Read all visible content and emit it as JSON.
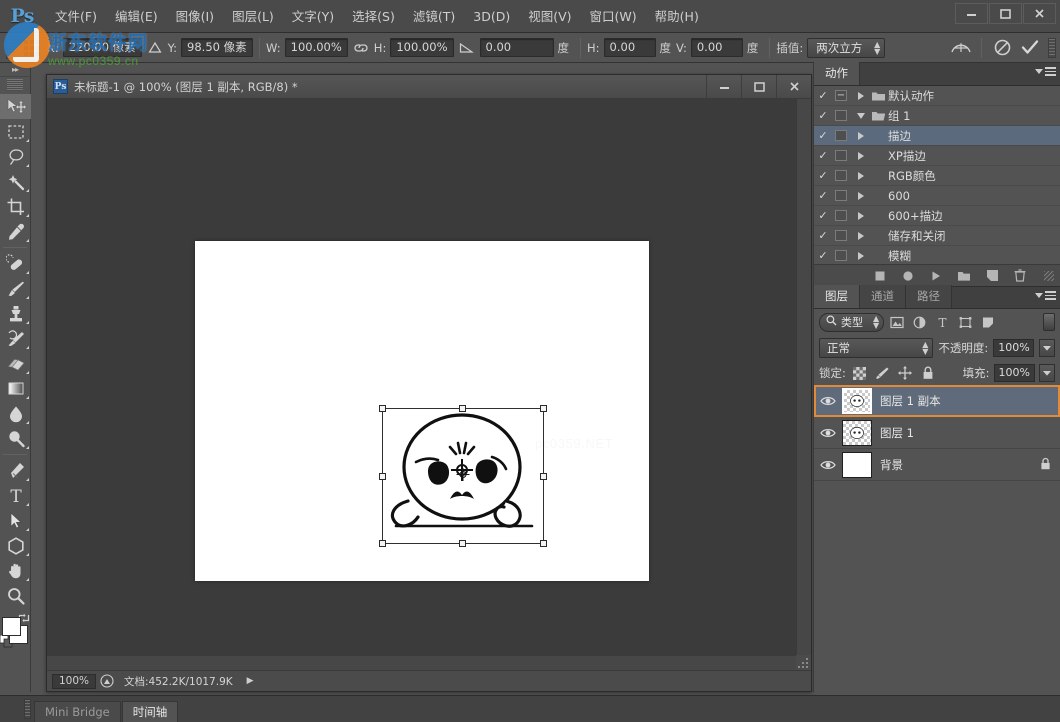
{
  "app": {
    "name": "Adobe Photoshop",
    "logo_text": "Ps"
  },
  "watermark": {
    "brand": "浙东软件网",
    "url": "www.pc0359.cn",
    "canvas_text": "pc0359.NET"
  },
  "menubar": {
    "items": [
      {
        "label": "文件(F)"
      },
      {
        "label": "编辑(E)"
      },
      {
        "label": "图像(I)"
      },
      {
        "label": "图层(L)"
      },
      {
        "label": "文字(Y)"
      },
      {
        "label": "选择(S)"
      },
      {
        "label": "滤镜(T)"
      },
      {
        "label": "3D(D)"
      },
      {
        "label": "视图(V)"
      },
      {
        "label": "窗口(W)"
      },
      {
        "label": "帮助(H)"
      }
    ],
    "window_controls": {
      "minimize": "minimize-icon",
      "maximize": "maximize-icon",
      "close": "close-icon"
    }
  },
  "options_bar": {
    "tool_icon": "reference-point-icon",
    "x_label": "X:",
    "x_value": "220.00 像素",
    "y_label": "Y:",
    "y_value": "98.50 像素",
    "relative_icon": "delta-triangle-icon",
    "w_label": "W:",
    "w_value": "100.00%",
    "link_icon": "chain-link-icon",
    "h_label": "H:",
    "h_value": "100.00%",
    "rotate_icon": "angle-icon",
    "rotate_value": "0.00",
    "rotate_unit": "度",
    "skew_h_label": "H:",
    "skew_h_value": "0.00",
    "skew_h_unit": "度",
    "skew_v_label": "V:",
    "skew_v_value": "0.00",
    "skew_v_unit": "度",
    "interp_label": "插值:",
    "interp_value": "两次立方",
    "warp_icon": "warp-mode-icon",
    "cancel_icon": "cancel-transform-icon",
    "commit_icon": "commit-transform-icon"
  },
  "toolbar": {
    "collapse_icon": "double-chevron-right-icon",
    "tools": [
      {
        "name": "move-tool",
        "icon": "move-icon",
        "has_submenu": false,
        "selected": true
      },
      {
        "name": "rectangular-marquee-tool",
        "icon": "marquee-icon",
        "has_submenu": true
      },
      {
        "name": "lasso-tool",
        "icon": "lasso-icon",
        "has_submenu": true
      },
      {
        "name": "magic-wand-tool",
        "icon": "magic-wand-icon",
        "has_submenu": true
      },
      {
        "name": "crop-tool",
        "icon": "crop-icon",
        "has_submenu": true
      },
      {
        "name": "eyedropper-tool",
        "icon": "eyedropper-icon",
        "has_submenu": true
      },
      {
        "name": "spot-healing-brush-tool",
        "icon": "healing-brush-icon",
        "has_submenu": true
      },
      {
        "name": "brush-tool",
        "icon": "brush-icon",
        "has_submenu": true
      },
      {
        "name": "clone-stamp-tool",
        "icon": "clone-stamp-icon",
        "has_submenu": true
      },
      {
        "name": "history-brush-tool",
        "icon": "history-brush-icon",
        "has_submenu": true
      },
      {
        "name": "eraser-tool",
        "icon": "eraser-icon",
        "has_submenu": true
      },
      {
        "name": "gradient-tool",
        "icon": "gradient-icon",
        "has_submenu": true
      },
      {
        "name": "blur-tool",
        "icon": "blur-drop-icon",
        "has_submenu": true
      },
      {
        "name": "dodge-tool",
        "icon": "dodge-icon",
        "has_submenu": true
      },
      {
        "name": "pen-tool",
        "icon": "pen-icon",
        "has_submenu": true
      },
      {
        "name": "horizontal-type-tool",
        "icon": "text-t-icon",
        "has_submenu": true
      },
      {
        "name": "path-selection-tool",
        "icon": "path-arrow-icon",
        "has_submenu": true
      },
      {
        "name": "shape-tool",
        "icon": "polygon-shape-icon",
        "has_submenu": true
      },
      {
        "name": "hand-tool",
        "icon": "hand-icon",
        "has_submenu": true
      },
      {
        "name": "zoom-tool",
        "icon": "magnifier-icon",
        "has_submenu": false
      }
    ],
    "default_colors_icon": "default-colors-icon",
    "swap_colors_icon": "swap-colors-icon",
    "foreground_color": "#ffffff",
    "background_color": "#ffffff"
  },
  "document": {
    "badge": "Ps",
    "title": "未标题-1 @ 100% (图层 1 副本, RGB/8) *",
    "window_controls": {
      "minimize": "minimize-icon",
      "maximize": "maximize-icon",
      "close": "close-icon"
    },
    "status": {
      "zoom": "100%",
      "preview_icon": "doc-preview-icon",
      "doc_info": "文档:452.2K/1017.9K",
      "expand_icon": "status-arrow-icon"
    }
  },
  "actions_panel": {
    "tab": "动作",
    "menu_icon": "panel-menu-icon",
    "rows": [
      {
        "check": "✓",
        "box": "−",
        "arrow": "right",
        "folder": true,
        "label": "默认动作",
        "selected": false
      },
      {
        "check": "✓",
        "box": "",
        "arrow": "down",
        "folder": true,
        "label": "组 1",
        "selected": false
      },
      {
        "check": "✓",
        "box": "",
        "arrow": "right",
        "folder": false,
        "label": "描边",
        "selected": true
      },
      {
        "check": "✓",
        "box": "",
        "arrow": "right",
        "folder": false,
        "label": "XP描边",
        "selected": false
      },
      {
        "check": "✓",
        "box": "",
        "arrow": "right",
        "folder": false,
        "label": "RGB颜色",
        "selected": false
      },
      {
        "check": "✓",
        "box": "",
        "arrow": "right",
        "folder": false,
        "label": "600",
        "selected": false
      },
      {
        "check": "✓",
        "box": "",
        "arrow": "right",
        "folder": false,
        "label": "600+描边",
        "selected": false
      },
      {
        "check": "✓",
        "box": "",
        "arrow": "right",
        "folder": false,
        "label": "储存和关闭",
        "selected": false
      },
      {
        "check": "✓",
        "box": "",
        "arrow": "right",
        "folder": false,
        "label": "模糊",
        "selected": false
      }
    ],
    "footer_icons": [
      "stop-icon",
      "record-icon",
      "play-icon",
      "new-set-icon",
      "new-action-icon",
      "delete-icon"
    ]
  },
  "layers_panel": {
    "tabs": [
      {
        "label": "图层",
        "active": true
      },
      {
        "label": "通道",
        "active": false
      },
      {
        "label": "路径",
        "active": false
      }
    ],
    "menu_icon": "panel-menu-icon",
    "filter": {
      "search_icon": "search-icon",
      "type_label": "类型",
      "icons": [
        "filter-image-icon",
        "filter-adjustment-icon",
        "filter-type-icon",
        "filter-shape-icon",
        "filter-smart-icon"
      ],
      "toggle_icon": "filter-toggle-icon"
    },
    "blend_mode": "正常",
    "opacity_label": "不透明度:",
    "opacity_value": "100%",
    "lock_label": "锁定:",
    "lock_icons": [
      "lock-transparency-icon",
      "lock-image-icon",
      "lock-position-icon",
      "lock-all-icon"
    ],
    "fill_label": "填充:",
    "fill_value": "100%",
    "layers": [
      {
        "visible": true,
        "name": "图层 1 副本",
        "selected": true,
        "thumb": "transparent",
        "locked": false
      },
      {
        "visible": true,
        "name": "图层 1",
        "selected": false,
        "thumb": "transparent",
        "locked": false
      },
      {
        "visible": true,
        "name": "背景",
        "selected": false,
        "thumb": "white",
        "locked": true,
        "lock_icon": "lock-icon"
      }
    ]
  },
  "bottom_bar": {
    "tabs": [
      {
        "label": "Mini Bridge",
        "active": false
      },
      {
        "label": "时间轴",
        "active": true
      }
    ]
  }
}
